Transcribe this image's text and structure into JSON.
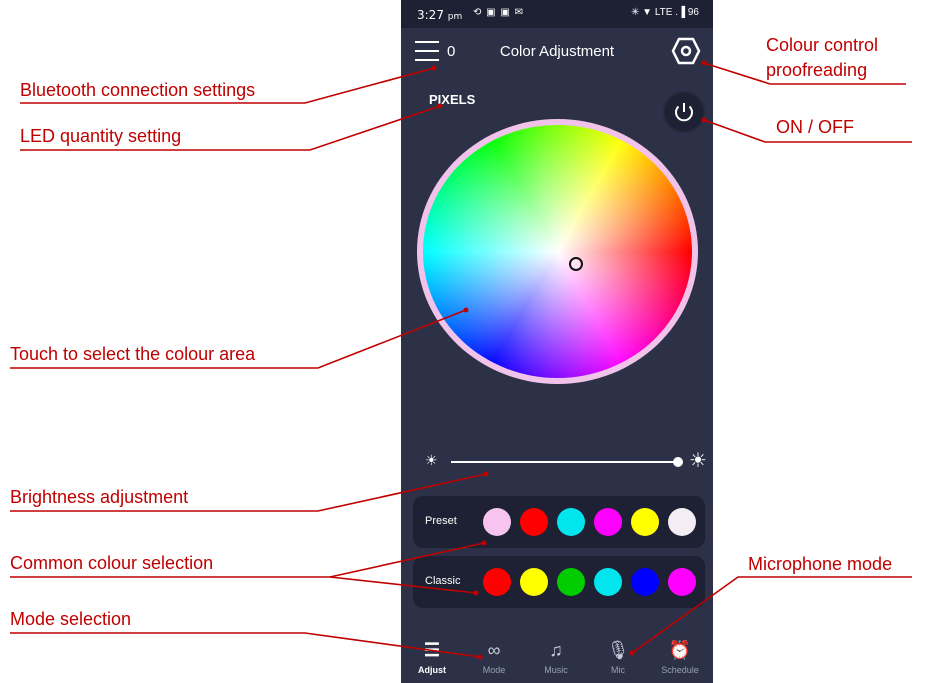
{
  "status_bar": {
    "time": "3:27",
    "ampm": "pm",
    "left_icons": "⟲ ▣ ▣ ✉",
    "right_icons": "✳ ▼ LTE .▐ 96"
  },
  "header": {
    "menu_count": "0",
    "title": "Color Adjustment"
  },
  "pixels_label": "PIXELS",
  "colors": {
    "background": "#2d3148",
    "panel": "#1e2133",
    "accent_red": "#c00000"
  },
  "swatches": {
    "preset": {
      "label": "Preset",
      "colors": [
        "#f7c4f0",
        "#ff0000",
        "#00e5ee",
        "#ff00ff",
        "#ffff00",
        "#f4eef4"
      ]
    },
    "classic": {
      "label": "Classic",
      "colors": [
        "#ff0000",
        "#ffff00",
        "#00cc00",
        "#00e5ee",
        "#0000ff",
        "#ff00ff"
      ]
    }
  },
  "brightness": {
    "value": 1.0
  },
  "nav": [
    {
      "label": "Adjust",
      "icon": "sliders-icon",
      "active": true
    },
    {
      "label": "Mode",
      "icon": "grid-circles-icon",
      "active": false
    },
    {
      "label": "Music",
      "icon": "music-note-icon",
      "active": false
    },
    {
      "label": "Mic",
      "icon": "microphone-icon",
      "active": false
    },
    {
      "label": "Schedule",
      "icon": "alarm-clock-icon",
      "active": false
    }
  ],
  "annotations": {
    "bluetooth": "Bluetooth connection settings",
    "led_qty": "LED quantity setting",
    "colour_control_1": "Colour control",
    "colour_control_2": "proofreading",
    "on_off": "ON / OFF",
    "touch": "Touch to select the colour area",
    "brightness": "Brightness adjustment",
    "common": "Common colour selection",
    "microphone": "Microphone mode",
    "mode": "Mode selection"
  }
}
